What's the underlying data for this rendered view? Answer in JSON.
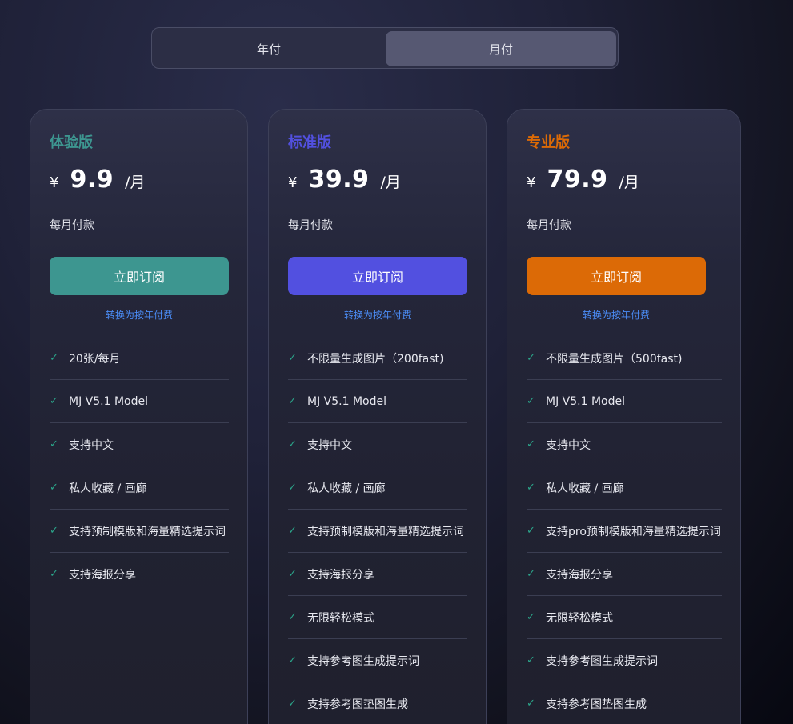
{
  "billing_toggle": {
    "yearly_label": "年付",
    "monthly_label": "月付",
    "selected": "月付"
  },
  "colors": {
    "trial": "#3d9690",
    "standard": "#5250e0",
    "pro": "#dc6a06",
    "check": "#2ba58a",
    "link": "#4b8cf5"
  },
  "plans": [
    {
      "name": "体验版",
      "currency": "¥",
      "price": "9.9",
      "unit": "/月",
      "billing_note": "每月付款",
      "subscribe_label": "立即订阅",
      "switch_link": "转换为按年付费",
      "features": [
        "20张/每月",
        "MJ V5.1 Model",
        "支持中文",
        "私人收藏 / 画廊",
        "支持预制模版和海量精选提示词",
        "支持海报分享"
      ]
    },
    {
      "name": "标准版",
      "currency": "¥",
      "price": "39.9",
      "unit": "/月",
      "billing_note": "每月付款",
      "subscribe_label": "立即订阅",
      "switch_link": "转换为按年付费",
      "features": [
        "不限量生成图片（200fast)",
        "MJ V5.1 Model",
        "支持中文",
        "私人收藏 / 画廊",
        "支持预制模版和海量精选提示词",
        "支持海报分享",
        "无限轻松模式",
        "支持参考图生成提示词",
        "支持参考图垫图生成"
      ]
    },
    {
      "name": "专业版",
      "currency": "¥",
      "price": "79.9",
      "unit": "/月",
      "billing_note": "每月付款",
      "subscribe_label": "立即订阅",
      "switch_link": "转换为按年付费",
      "features": [
        "不限量生成图片（500fast)",
        "MJ V5.1 Model",
        "支持中文",
        "私人收藏 / 画廊",
        "支持pro预制模版和海量精选提示词",
        "支持海报分享",
        "无限轻松模式",
        "支持参考图生成提示词",
        "支持参考图垫图生成"
      ]
    }
  ]
}
